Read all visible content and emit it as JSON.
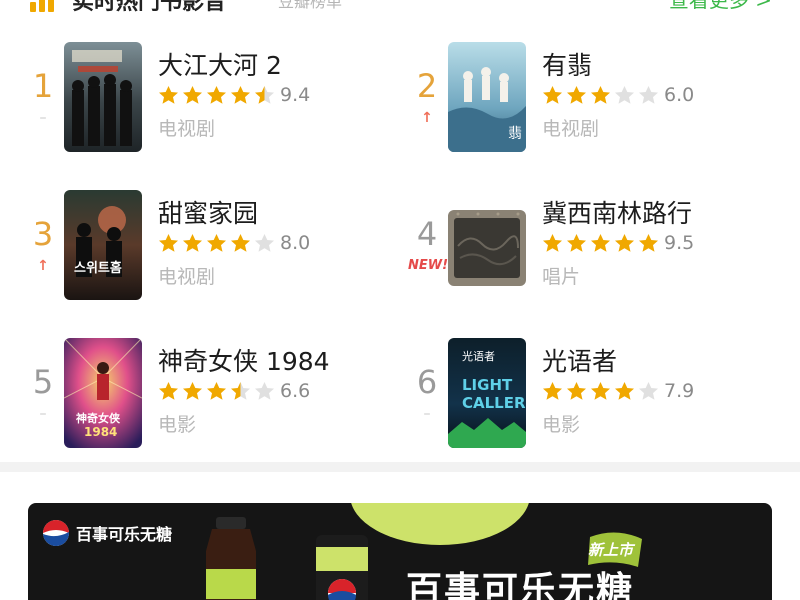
{
  "header": {
    "title": "实时热门书影音",
    "subtitle": "豆瓣榜单",
    "more_label": "查看更多 >"
  },
  "colors": {
    "accent_green": "#3cb84a",
    "star_filled": "#f0a800",
    "star_empty": "#e0e0e0",
    "rank_top": "#e5a33a",
    "rank_plain": "#9a9a9a",
    "trend_up": "#f0705a",
    "new_badge": "#e54a4a"
  },
  "rankings": [
    {
      "rank": "1",
      "trend": "–",
      "trend_type": "same",
      "title": "大江大河 2",
      "stars": 4.5,
      "score": "9.4",
      "category": "电视剧",
      "poster_icon": "poster-image"
    },
    {
      "rank": "2",
      "trend": "↑",
      "trend_type": "up",
      "title": "有翡",
      "stars": 3,
      "score": "6.0",
      "category": "电视剧",
      "poster_icon": "poster-image"
    },
    {
      "rank": "3",
      "trend": "↑",
      "trend_type": "up",
      "title": "甜蜜家园",
      "stars": 4,
      "score": "8.0",
      "category": "电视剧",
      "poster_icon": "poster-image"
    },
    {
      "rank": "4",
      "trend": "NEW!",
      "trend_type": "new",
      "title": "冀西南林路行",
      "stars": 5,
      "score": "9.5",
      "category": "唱片",
      "poster_icon": "album-cover"
    },
    {
      "rank": "5",
      "trend": "–",
      "trend_type": "same",
      "title": "神奇女侠 1984",
      "stars": 3.5,
      "score": "6.6",
      "category": "电影",
      "poster_icon": "poster-image"
    },
    {
      "rank": "6",
      "trend": "–",
      "trend_type": "same",
      "title": "光语者",
      "stars": 4,
      "score": "7.9",
      "category": "电影",
      "poster_icon": "poster-image"
    }
  ],
  "ad": {
    "brand": "百事可乐无糖",
    "badge": "新上市",
    "headline": "百事可乐无糖"
  }
}
